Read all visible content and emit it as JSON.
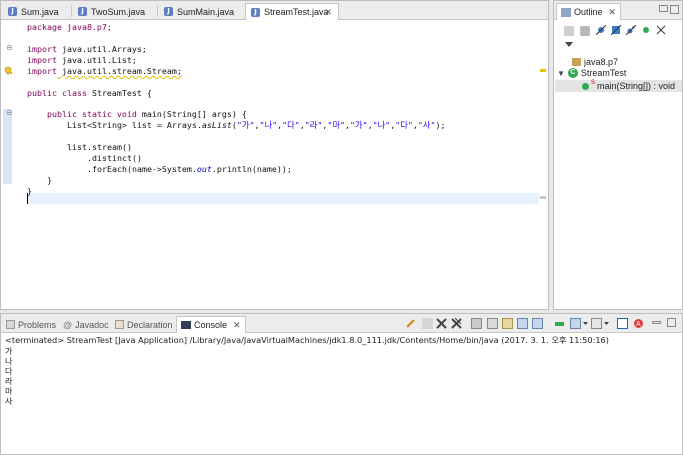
{
  "editor": {
    "tabs": [
      {
        "label": "Sum.java",
        "active": false
      },
      {
        "label": "TwoSum.java",
        "active": false
      },
      {
        "label": "SumMain.java",
        "active": false
      },
      {
        "label": "StreamTest.java",
        "active": true
      }
    ],
    "close_glyph": "✕",
    "code": {
      "l1": [
        "package java8.p7;"
      ],
      "l3": [
        "import",
        " java.util.Arrays;"
      ],
      "l4": [
        "import",
        " java.util.List;"
      ],
      "l5": [
        "import",
        " java.util.stream.Stream;"
      ],
      "l7": [
        "public class",
        " StreamTest {"
      ],
      "l9": [
        "public static void",
        " main(String[] args) {"
      ],
      "l10a": "List<String> list = Arrays.",
      "l10b": "asList",
      "l10c": "(",
      "l10args": [
        "\"가\"",
        "\"나\"",
        "\"다\"",
        "\"라\"",
        "\"마\"",
        "\"가\"",
        "\"나\"",
        "\"다\"",
        "\"사\""
      ],
      "l10d": ");",
      "l12": "list.stream()",
      "l13": ".distinct()",
      "l14a": ".forEach(name->System.",
      "l14b": "out",
      "l14c": ".println(name));",
      "l15": "}",
      "l16": "}"
    }
  },
  "outline": {
    "title": "Outline",
    "items": [
      {
        "label": "java8.p7"
      },
      {
        "label": "StreamTest"
      },
      {
        "label": "main(String[]) : void",
        "badge": "S"
      }
    ]
  },
  "console": {
    "tabs": [
      {
        "label": "Problems"
      },
      {
        "label": "Javadoc"
      },
      {
        "label": "Declaration"
      },
      {
        "label": "Console",
        "active": true
      }
    ],
    "status": "<terminated> StreamTest [Java Application] /Library/Java/JavaVirtualMachines/jdk1.8.0_111.jdk/Contents/Home/bin/java (2017. 3. 1. 오후 11:50:16)",
    "output": [
      "가",
      "나",
      "다",
      "라",
      "마",
      "사"
    ]
  },
  "colors": {
    "keyword": "#7f0055",
    "string": "#2a00ff",
    "field": "#0000c0",
    "accent": "#5b7fbf"
  }
}
